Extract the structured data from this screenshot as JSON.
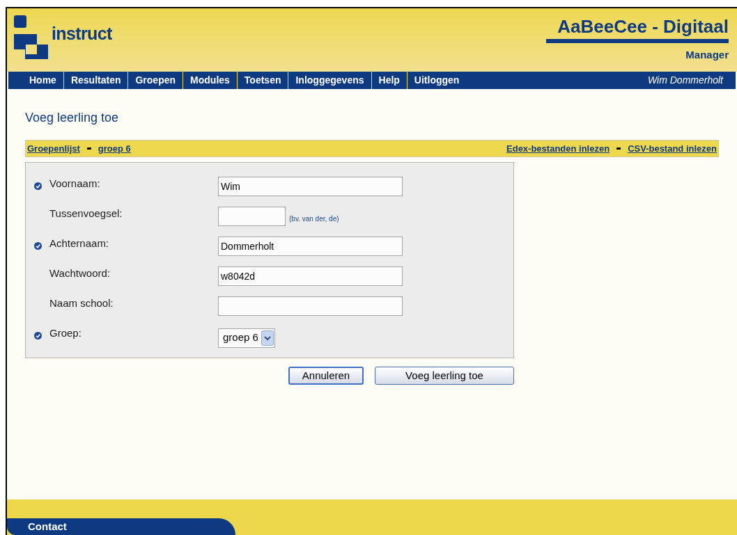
{
  "header": {
    "logo_text": "instruct",
    "title": "AaBeeCee - Digitaal",
    "subtitle": "Manager"
  },
  "nav": {
    "items": [
      {
        "label": "Home"
      },
      {
        "label": "Resultaten"
      },
      {
        "label": "Groepen"
      },
      {
        "label": "Modules"
      },
      {
        "label": "Toetsen"
      },
      {
        "label": "Inloggegevens"
      },
      {
        "label": "Help"
      },
      {
        "label": "Uitloggen"
      }
    ],
    "user": "Wim Dommerholt"
  },
  "page_title": "Voeg leerling toe",
  "breadcrumbs": [
    "Groepenlijst",
    "groep 6"
  ],
  "actions": [
    "Edex-bestanden inlezen",
    "CSV-bestand inlezen"
  ],
  "fields": [
    {
      "kind": "text",
      "label": "Voornaam:",
      "required": true,
      "value": "Wim"
    },
    {
      "kind": "short",
      "label": "Tussenvoegsel:",
      "required": false,
      "hint": "(bv. van der, de)"
    },
    {
      "kind": "text",
      "label": "Achternaam:",
      "required": true,
      "value": "Dommerholt"
    },
    {
      "kind": "text",
      "label": "Wachtwoord:",
      "required": false,
      "value": "w8042d"
    },
    {
      "kind": "text",
      "label": "Naam school:",
      "required": false
    },
    {
      "kind": "select",
      "label": "Groep:",
      "required": true,
      "value": "groep 6"
    }
  ],
  "buttons": [
    "Annuleren",
    "Voeg leerling toe"
  ],
  "footer": {
    "label": "Contact"
  }
}
